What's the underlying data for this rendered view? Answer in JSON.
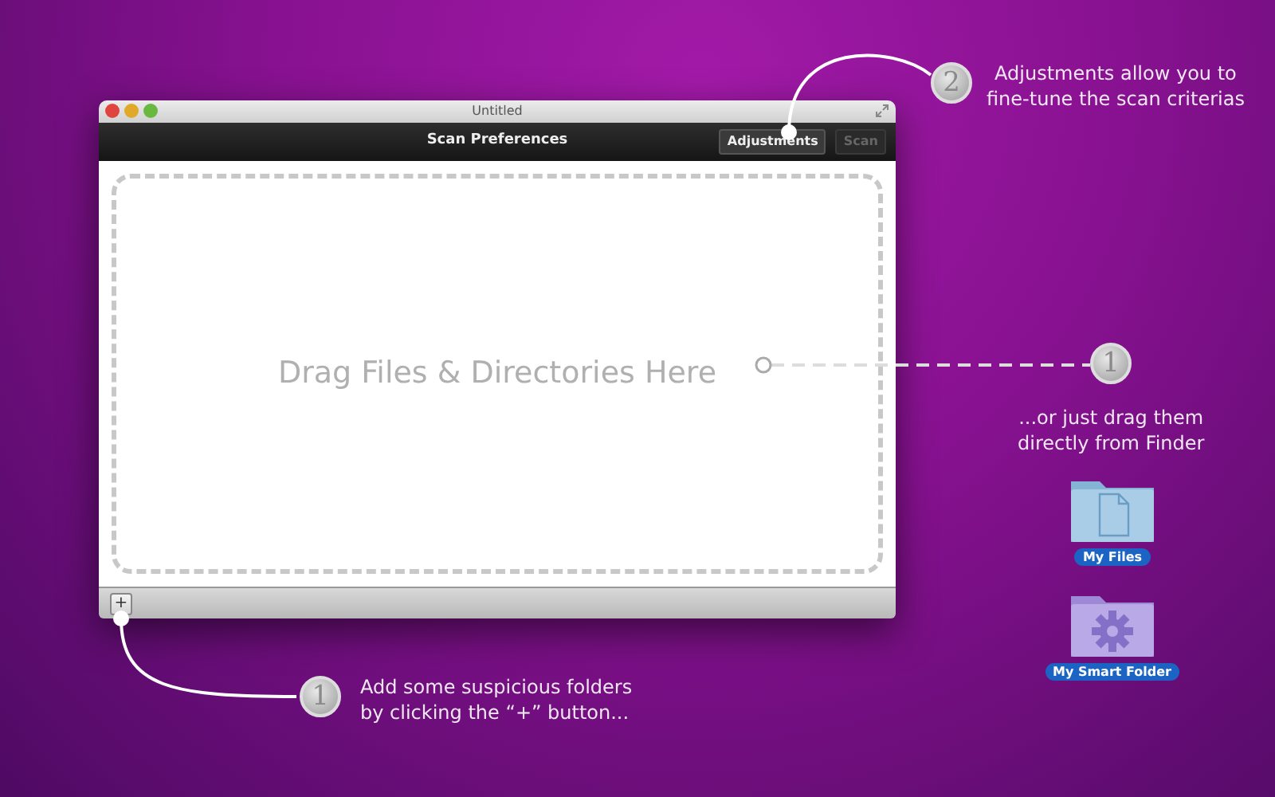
{
  "window": {
    "title": "Untitled",
    "toolbar_title": "Scan Preferences",
    "buttons": [
      {
        "label": "Adjustments",
        "disabled": false
      },
      {
        "label": "Scan",
        "disabled": true
      }
    ],
    "drop_zone": {
      "text": "Drag Files & Directories Here"
    },
    "add_button": "+"
  },
  "callouts": [
    {
      "number": "2",
      "lines": [
        "Adjustments allow you to",
        "fine-tune the scan criterias"
      ]
    },
    {
      "number": "1",
      "lines": [
        "...or just drag them",
        "directly from Finder"
      ]
    },
    {
      "number": "1",
      "lines": [
        "Add some suspicious folders",
        "by clicking the “+” button..."
      ]
    }
  ],
  "desktop_icons": [
    {
      "label": "My Files",
      "kind": "document"
    },
    {
      "label": "My Smart Folder",
      "kind": "smart"
    }
  ]
}
